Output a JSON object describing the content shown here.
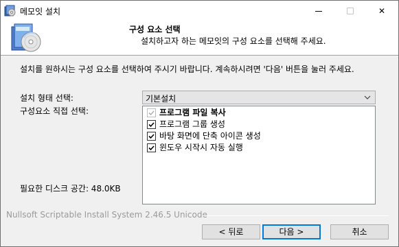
{
  "window": {
    "title": "메모잇 설치",
    "app_icon": "installer-cd-icon",
    "minimize_icon": "minimize-icon",
    "maximize_icon": "maximize-icon",
    "close_icon": "close-icon",
    "close_glyph": "✕"
  },
  "header": {
    "title": "구성 요소 선택",
    "subtitle": "설치하고자 하는 메모잇의 구성 요소를 선택해 주세요.",
    "art_icon": "cd-package-icon"
  },
  "body": {
    "intro": "설치를 원하시는 구성 요소를 선택하여 주시기 바랍니다. 계속하시려면 '다음' 버튼을 눌러 주세요.",
    "install_type_label": "설치 형태 선택:",
    "component_select_label": "구성요소 직접 선택:",
    "disk_space_label": "필요한 디스크 공간: 48.0KB",
    "install_type_value": "기본설치",
    "components": [
      {
        "label": "프로그램 파일 복사",
        "checked": true,
        "disabled": true,
        "bold": true
      },
      {
        "label": "프로그램 그룹 생성",
        "checked": true,
        "disabled": false,
        "bold": false
      },
      {
        "label": "바탕 화면에 단축 아이콘 생성",
        "checked": true,
        "disabled": false,
        "bold": false
      },
      {
        "label": "윈도우 시작시 자동 실행",
        "checked": true,
        "disabled": false,
        "bold": false
      }
    ]
  },
  "footer": {
    "brand": "Nullsoft Scriptable Install System 2.46.5 Unicode",
    "back_label": "< 뒤로",
    "next_label": "다음 >",
    "cancel_label": "취소"
  }
}
